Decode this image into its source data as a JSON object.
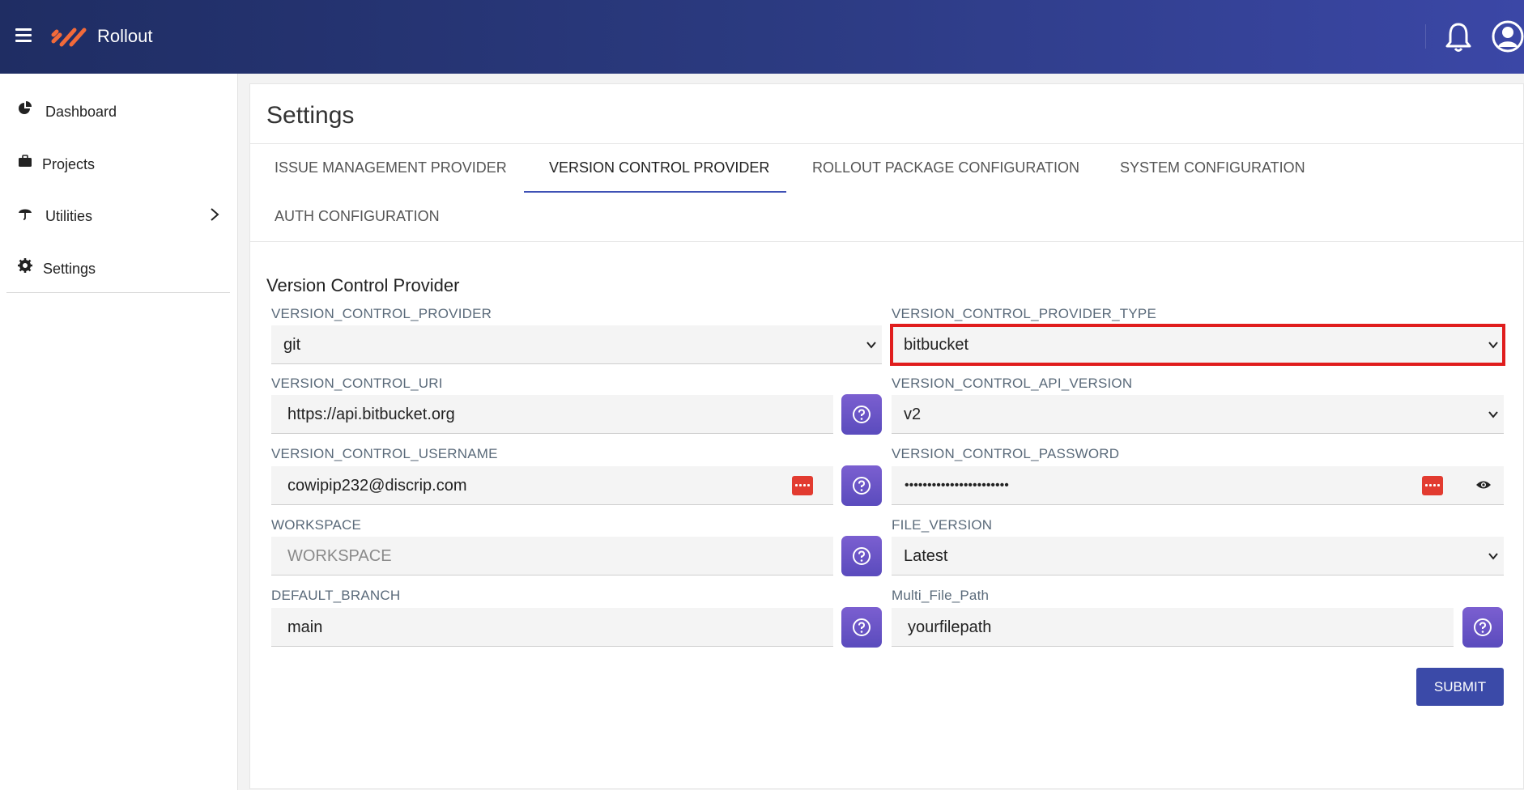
{
  "app": {
    "brand": "Rollout"
  },
  "sidebar": {
    "items": [
      {
        "label": "Dashboard",
        "icon": "pie-chart-icon"
      },
      {
        "label": "Projects",
        "icon": "briefcase-icon"
      },
      {
        "label": "Utilities",
        "icon": "umbrella-icon"
      },
      {
        "label": "Settings",
        "icon": "gear-icon"
      }
    ]
  },
  "page": {
    "title": "Settings",
    "section_title": "Version Control Provider"
  },
  "tabs": [
    {
      "label": "ISSUE MANAGEMENT PROVIDER",
      "active": false
    },
    {
      "label": "VERSION CONTROL PROVIDER",
      "active": true
    },
    {
      "label": "ROLLOUT PACKAGE CONFIGURATION",
      "active": false
    },
    {
      "label": "SYSTEM CONFIGURATION",
      "active": false
    },
    {
      "label": "AUTH CONFIGURATION",
      "active": false
    }
  ],
  "form": {
    "provider": {
      "label": "VERSION_CONTROL_PROVIDER",
      "value": "git"
    },
    "provider_type": {
      "label": "VERSION_CONTROL_PROVIDER_TYPE",
      "value": "bitbucket"
    },
    "uri": {
      "label": "VERSION_CONTROL_URI",
      "value": "https://api.bitbucket.org"
    },
    "api_version": {
      "label": "VERSION_CONTROL_API_VERSION",
      "value": "v2"
    },
    "username": {
      "label": "VERSION_CONTROL_USERNAME",
      "value": "cowipip232@discrip.com"
    },
    "password": {
      "label": "VERSION_CONTROL_PASSWORD",
      "value": "•••••••••••••••••••••••"
    },
    "workspace": {
      "label": "WORKSPACE",
      "placeholder": "WORKSPACE"
    },
    "file_version": {
      "label": "FILE_VERSION",
      "value": "Latest"
    },
    "default_branch": {
      "label": "DEFAULT_BRANCH",
      "value": "main"
    },
    "multi_file_path": {
      "label": "Multi_File_Path",
      "value": "yourfilepath"
    },
    "submit_label": "SUBMIT"
  },
  "colors": {
    "accent": "#3f51b5",
    "highlight": "#e01d1d",
    "help_button": "#6a55c8",
    "password_manager": "#e23b30"
  }
}
